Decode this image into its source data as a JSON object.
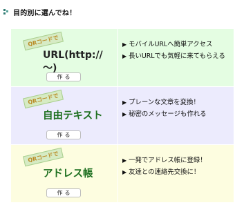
{
  "heading": {
    "title": "目的別に選んでね！"
  },
  "rows": [
    {
      "logo_tag": "QRコードで",
      "logo_text": "URL(http://～)",
      "button_label": "作る",
      "lines": [
        "モバイルURLへ簡単アクセス",
        "長いURLでも気軽に来てもらえる"
      ]
    },
    {
      "logo_tag": "QRコードで",
      "logo_text": "自由テキスト",
      "button_label": "作る",
      "lines": [
        "プレーンな文章を変換！",
        "秘密のメッセージも作れる"
      ]
    },
    {
      "logo_tag": "QRコードで",
      "logo_text": "アドレス帳",
      "button_label": "作る",
      "lines": [
        "一発でアドレス帳に登録！",
        "友達との連絡先交換に！"
      ]
    }
  ],
  "colors": {
    "row_1_bg": "#e4fde2",
    "row_2_bg": "#ecebfd",
    "row_3_bg": "#fdfde0",
    "bullet_accent": "#2f7a72"
  },
  "icons": {
    "heading_bullet": "diamond-dots-icon",
    "list_bullet": "triangle-right-icon"
  }
}
